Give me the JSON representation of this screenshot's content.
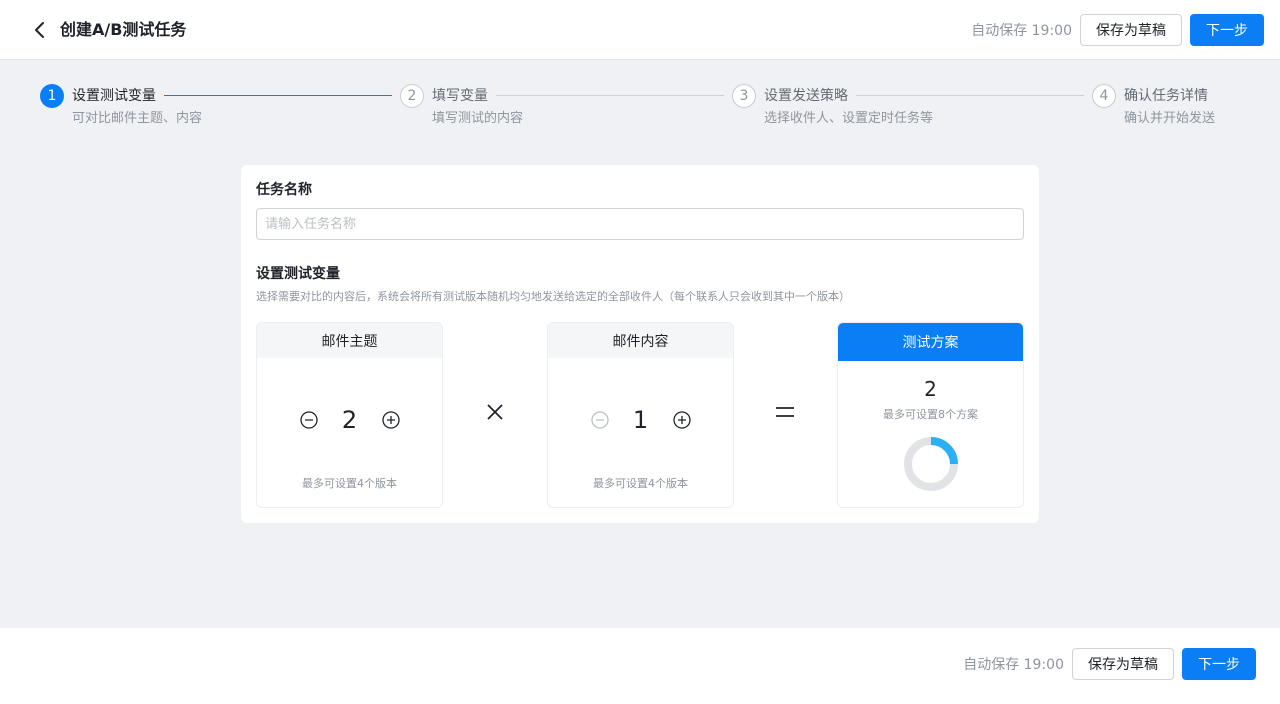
{
  "header": {
    "title": "创建A/B测试任务",
    "autosave": "自动保存 19:00",
    "save_draft": "保存为草稿",
    "next": "下一步"
  },
  "steps": [
    {
      "num": "1",
      "title": "设置测试变量",
      "desc": "可对比邮件主题、内容",
      "state": "active"
    },
    {
      "num": "2",
      "title": "填写变量",
      "desc": "填写测试的内容",
      "state": "idle"
    },
    {
      "num": "3",
      "title": "设置发送策略",
      "desc": "选择收件人、设置定时任务等",
      "state": "idle"
    },
    {
      "num": "4",
      "title": "确认任务详情",
      "desc": "确认并开始发送",
      "state": "idle"
    }
  ],
  "form": {
    "task_name_label": "任务名称",
    "task_name_value": "",
    "task_name_placeholder": "请输入任务名称",
    "variables_label": "设置测试变量",
    "variables_hint": "选择需要对比的内容后，系统会将所有测试版本随机均匀地发送给选定的全部收件人（每个联系人只会收到其中一个版本）"
  },
  "subject_box": {
    "title": "邮件主题",
    "count": "2",
    "limit": "最多可设置4个版本"
  },
  "content_box": {
    "title": "邮件内容",
    "count": "1",
    "limit": "最多可设置4个版本"
  },
  "result_box": {
    "title": "测试方案",
    "count": "2",
    "limit": "最多可设置8个方案",
    "fill_fraction": 0.25,
    "fill_color": "#2bb0f5",
    "track_color": "#e1e3e6"
  },
  "footer": {
    "autosave": "自动保存 19:00",
    "save_draft": "保存为草稿",
    "next": "下一步"
  },
  "colors": {
    "primary": "#0a7ff5",
    "background": "#f0f1f5"
  }
}
